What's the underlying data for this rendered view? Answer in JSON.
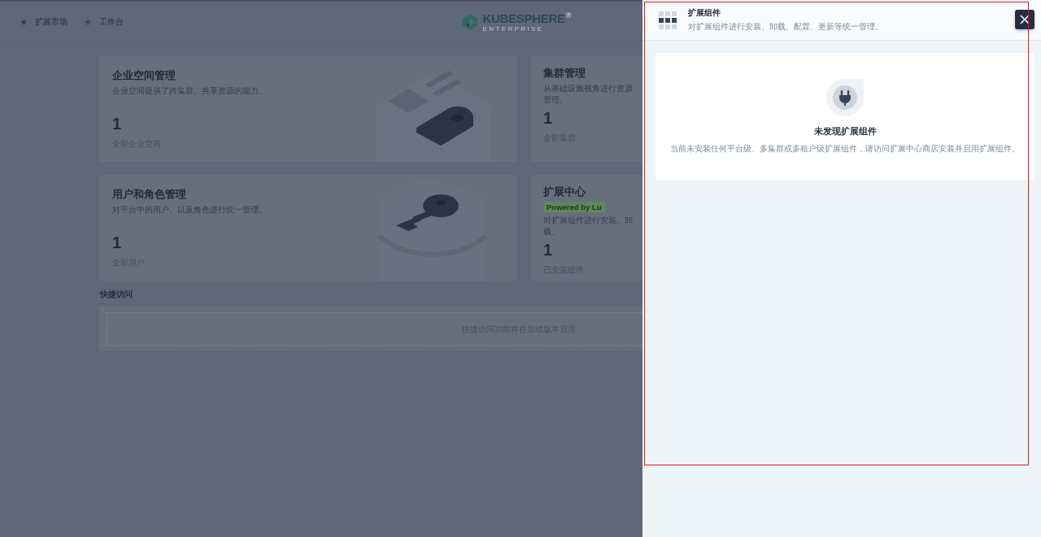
{
  "top_nav": {
    "links": [
      {
        "label": "扩展市场"
      },
      {
        "label": "工作台"
      }
    ],
    "logo": {
      "name": "KUBESPHERE",
      "mark": "®",
      "edition": "ENTERPRISE"
    }
  },
  "cards": [
    {
      "title": "企业空间管理",
      "description": "企业空间提供了跨集群、共享资源的能力。",
      "count": "1",
      "count_label": "全部企业空间"
    },
    {
      "title": "集群管理",
      "description": "从基础设施视角进行资源管理。",
      "count": "1",
      "count_label": "全部集群"
    },
    {
      "title": "用户和角色管理",
      "description": "对平台中的用户、以及角色进行统一管理。",
      "count": "1",
      "count_label": "全部用户"
    },
    {
      "title": "扩展中心",
      "badge": "Powered by Lu",
      "description": "对扩展组件进行安装、卸载、",
      "count": "1",
      "count_label": "已安装组件"
    }
  ],
  "quick_access": {
    "title": "快捷访问",
    "empty_text": "快捷访问功能将在后续版本启用"
  },
  "drawer": {
    "title": "扩展组件",
    "subtitle": "对扩展组件进行安装、卸载、配置、更新等统一管理。",
    "empty_title": "未发现扩展组件",
    "empty_text": "当前未安装任何平台级、多集群或多租户级扩展组件，请访问扩展中心商店安装并启用扩展组件。"
  }
}
